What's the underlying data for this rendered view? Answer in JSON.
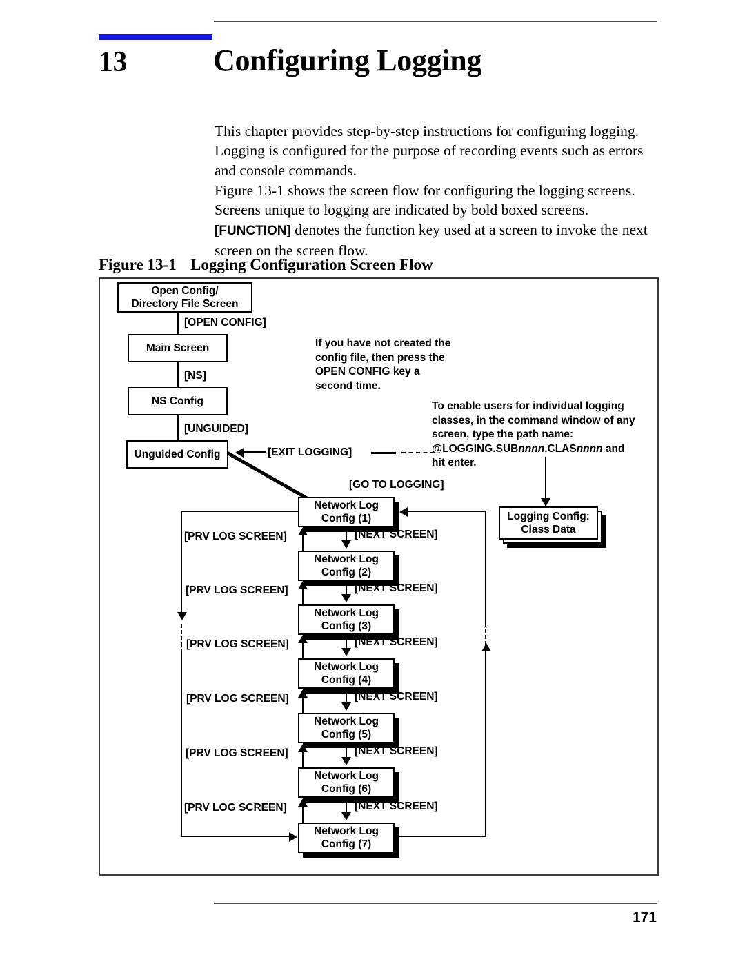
{
  "page": {
    "chapter_number": "13",
    "chapter_title": "Configuring Logging",
    "page_number": "171",
    "accent_color": "#1414e6"
  },
  "paragraphs": {
    "p1": "This chapter provides step-by-step instructions for configuring logging. Logging is configured for the purpose of recording events such as errors and console commands.",
    "p2_before": "Figure 13-1 shows the screen flow for configuring the logging screens. Screens unique to logging are indicated by bold boxed screens. ",
    "p2_key": "[FUNCTION]",
    "p2_after": " denotes the function key used at a screen to invoke the next screen on the screen flow."
  },
  "figure": {
    "label": "Figure 13-1",
    "title": "Logging Configuration Screen Flow",
    "boxes": {
      "open_config": "Open Config/\nDirectory File Screen",
      "open_config_l1": "Open Config/",
      "open_config_l2": "Directory File Screen",
      "main_screen": "Main Screen",
      "ns_config": "NS Config",
      "unguided_config": "Unguided Config",
      "logging_class_l1": "Logging Config:",
      "logging_class_l2": "Class Data",
      "netlog_title": "Network Log",
      "netlog_1": "Config (1)",
      "netlog_2": "Config (2)",
      "netlog_3": "Config (3)",
      "netlog_4": "Config (4)",
      "netlog_5": "Config (5)",
      "netlog_6": "Config (6)",
      "netlog_7": "Config (7)"
    },
    "edge_labels": {
      "open_config_key": "[OPEN CONFIG]",
      "ns_key": "[NS]",
      "unguided_key": "[UNGUIDED]",
      "exit_logging": "[EXIT LOGGING]",
      "go_to_logging": "[GO TO LOGGING]",
      "next_screen": "[NEXT SCREEN]",
      "prv_log_screen": "[PRV LOG SCREEN]"
    },
    "notes": {
      "note1": "If you have not created the config file, then press the OPEN CONFIG key a second time.",
      "note1_lines": [
        "If you have not created the",
        "config file, then press the",
        "OPEN CONFIG key a",
        "second time."
      ],
      "note2_lines": [
        "To enable users for individual logging",
        "classes, in the command window of any",
        "screen, type the path name:"
      ],
      "note2_path_pre": "@LOGGING.SUB",
      "note2_path_italic1": "nnnn",
      "note2_path_mid": ".CLAS",
      "note2_path_italic2": "nnnn",
      "note2_path_post": " and",
      "note2_last": "hit enter."
    }
  }
}
